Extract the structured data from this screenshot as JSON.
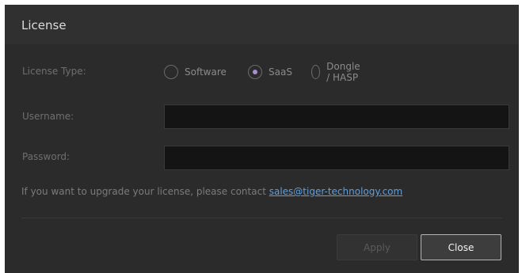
{
  "dialog": {
    "title": "License",
    "license_type_label": "License Type:",
    "license_options": [
      "Software",
      "SaaS",
      "Dongle / HASP"
    ],
    "selected_option": "SaaS",
    "username_label": "Username:",
    "password_label": "Password:",
    "info_text": "If you want to upgrade your license, please contact",
    "contact_email": "sales@tiger-technology.com",
    "apply_label": "Apply",
    "close_label": "Close"
  },
  "colors": {
    "background": "#2b2b2b",
    "accent": "#a98ed6",
    "link": "#5f9fe0"
  }
}
